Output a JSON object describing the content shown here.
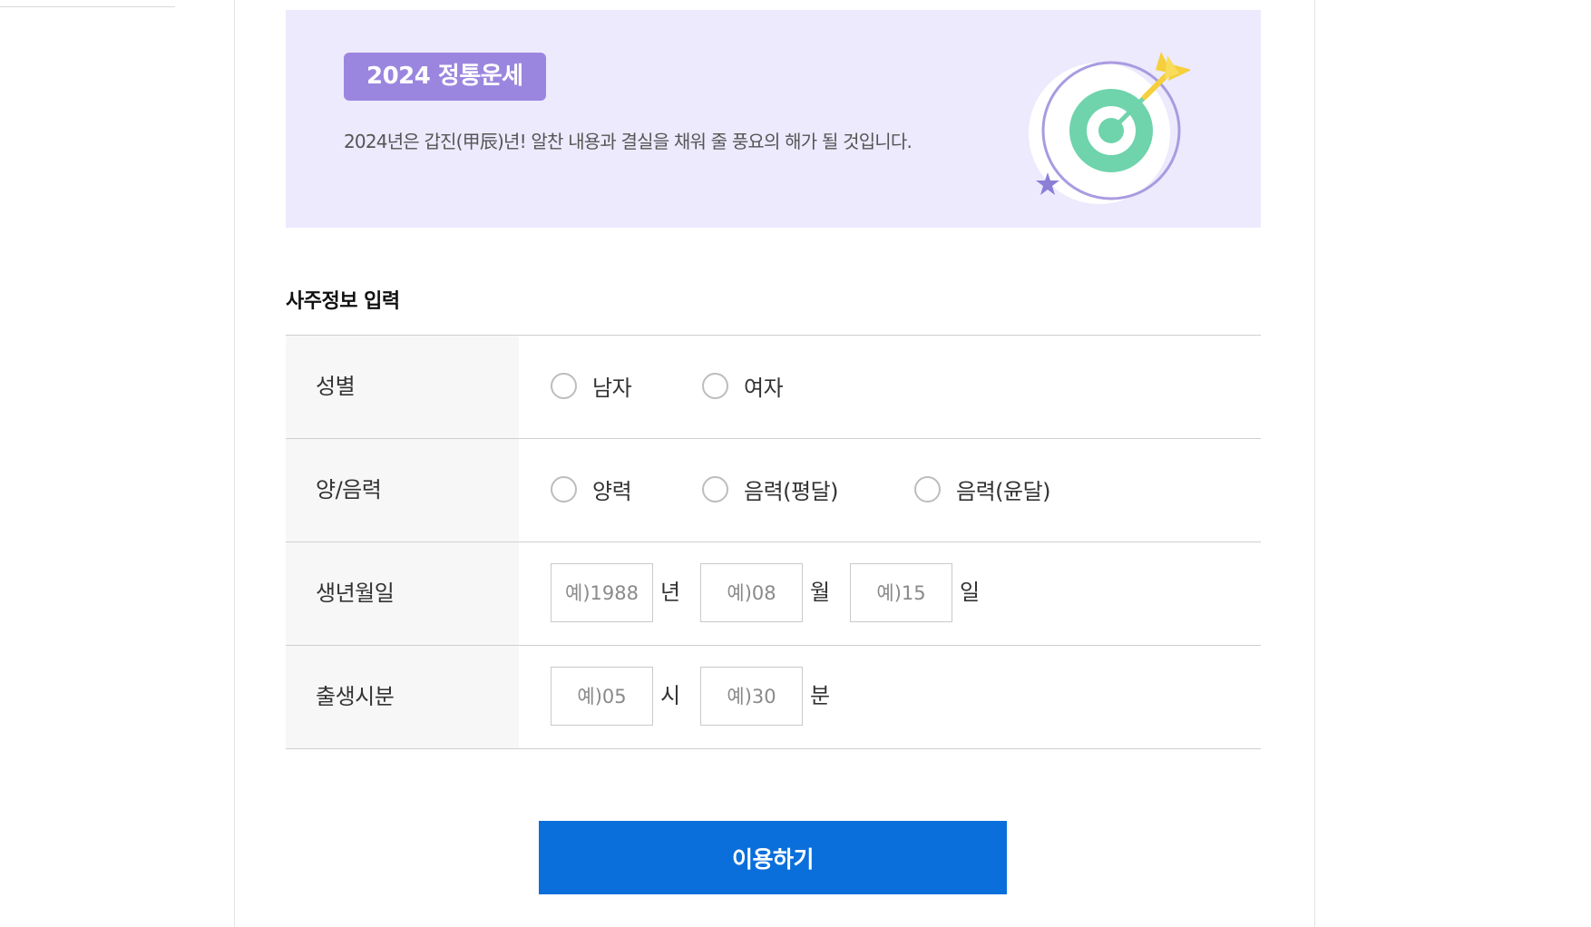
{
  "banner": {
    "badge": "2024 정통운세",
    "description": "2024년은 갑진(甲辰)년! 알찬 내용과 결실을 채워 줄 풍요의 해가 될 것입니다.",
    "illustration": "target-arrow-icon"
  },
  "form": {
    "title": "사주정보 입력",
    "gender": {
      "label": "성별",
      "options": [
        "남자",
        "여자"
      ]
    },
    "calendar": {
      "label": "양/음력",
      "options": [
        "양력",
        "음력(평달)",
        "음력(윤달)"
      ]
    },
    "birthdate": {
      "label": "생년월일",
      "year_placeholder": "예)1988",
      "year_unit": "년",
      "month_placeholder": "예)08",
      "month_unit": "월",
      "day_placeholder": "예)15",
      "day_unit": "일"
    },
    "birthtime": {
      "label": "출생시분",
      "hour_placeholder": "예)05",
      "hour_unit": "시",
      "minute_placeholder": "예)30",
      "minute_unit": "분"
    }
  },
  "submit_label": "이용하기",
  "colors": {
    "banner_bg": "#edeafd",
    "badge": "#9b86df",
    "button": "#0b6fdb",
    "target_ring": "#6fd3ac"
  }
}
